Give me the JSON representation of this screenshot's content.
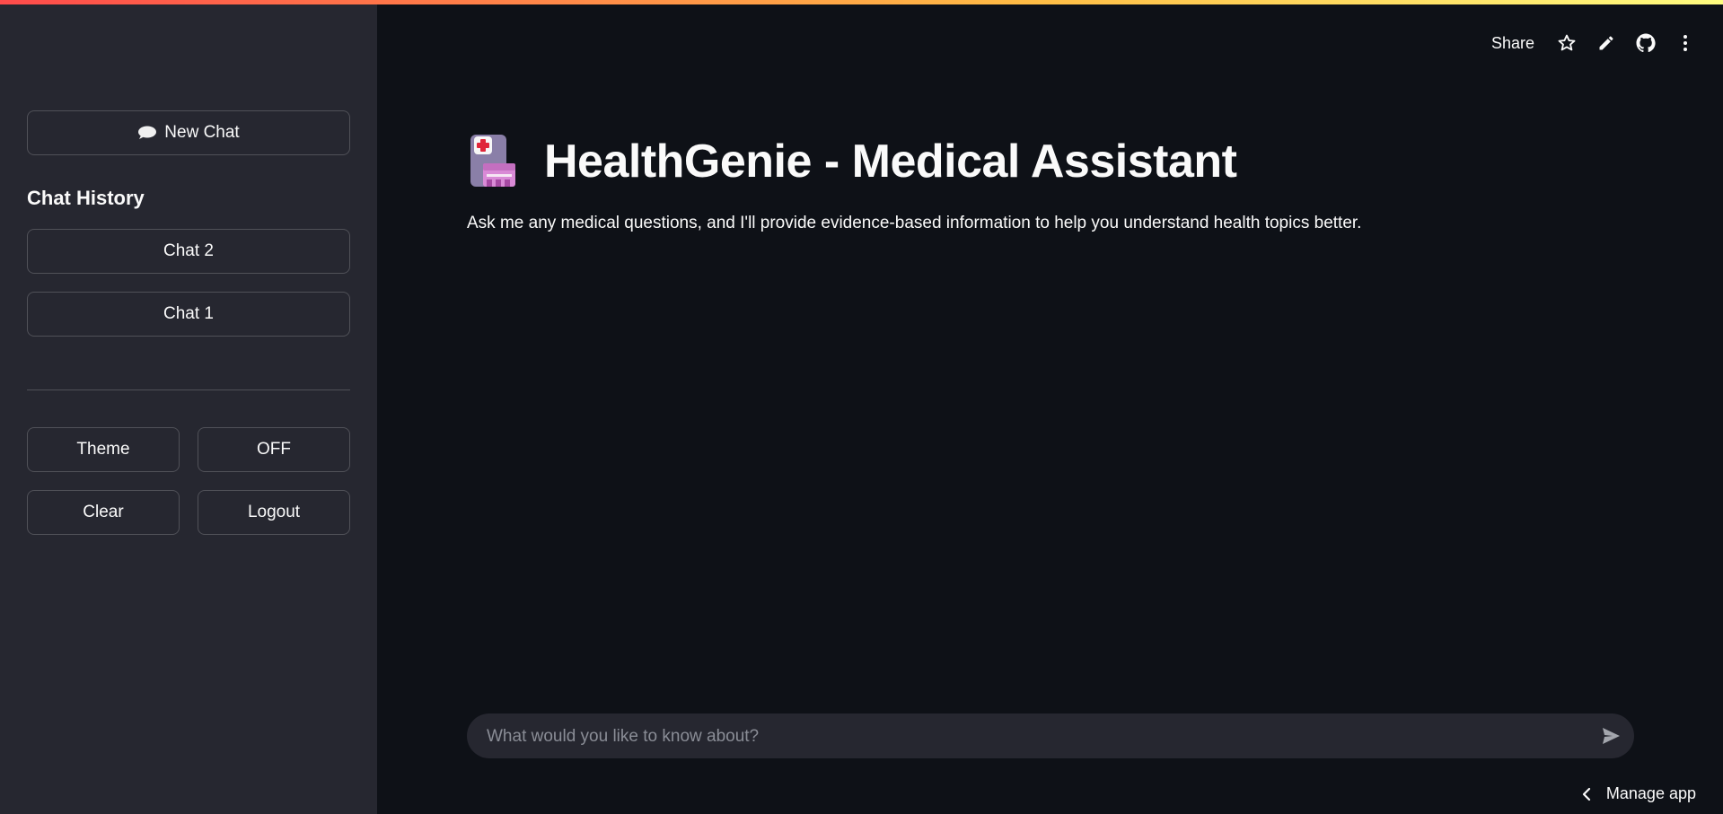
{
  "sidebar": {
    "new_chat_label": "New Chat",
    "history_title": "Chat History",
    "history": [
      {
        "label": "Chat 2"
      },
      {
        "label": "Chat 1"
      }
    ],
    "theme_label": "Theme",
    "toggle_label": "OFF",
    "clear_label": "Clear",
    "logout_label": "Logout"
  },
  "header": {
    "share_label": "Share",
    "icons": [
      "star-icon",
      "pencil-icon",
      "github-icon",
      "more-vert-icon"
    ]
  },
  "main": {
    "title": "HealthGenie - Medical Assistant",
    "title_icon": "hospital-icon",
    "subtitle": "Ask me any medical questions, and I'll provide evidence-based information to help you understand health topics better."
  },
  "chat_input": {
    "placeholder": "What would you like to know about?",
    "value": ""
  },
  "footer": {
    "manage_label": "Manage app"
  },
  "colors": {
    "background": "#0e1117",
    "sidebar": "#262730",
    "accent": "#ff4b4b",
    "text": "#fafafa"
  }
}
